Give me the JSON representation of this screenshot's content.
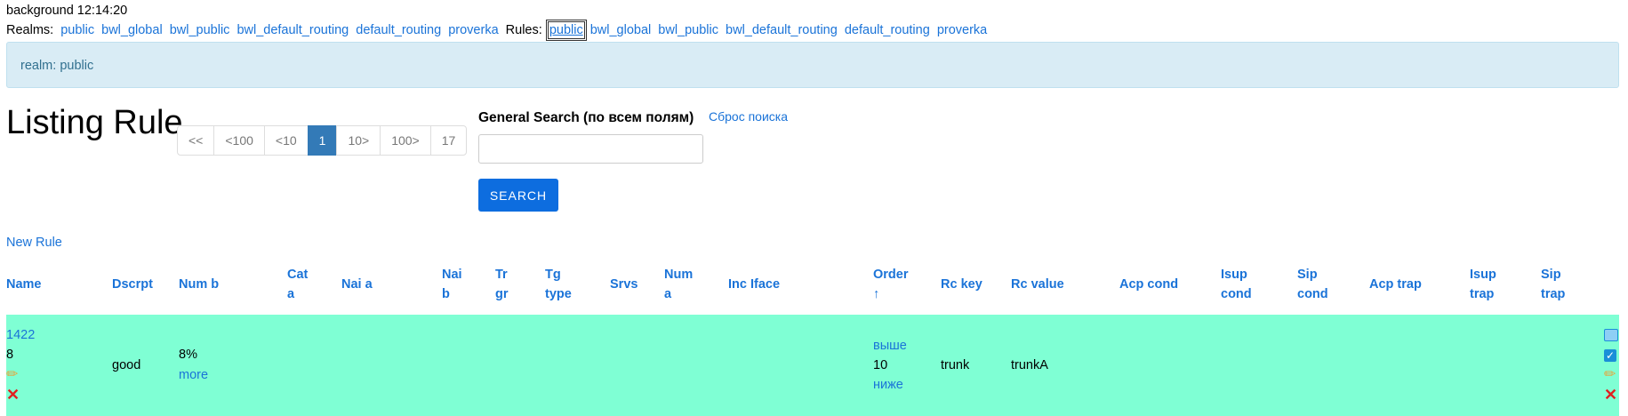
{
  "status": {
    "text": "background 12:14:20"
  },
  "realms": {
    "label": "Realms:",
    "items": [
      "public",
      "bwl_global",
      "bwl_public",
      "bwl_default_routing",
      "default_routing",
      "proverka"
    ]
  },
  "rules_nav": {
    "label": "Rules:",
    "active": "public",
    "items": [
      "bwl_global",
      "bwl_public",
      "bwl_default_routing",
      "default_routing",
      "proverka"
    ]
  },
  "alert": {
    "text": "realm: public"
  },
  "page_title": "Listing Rule",
  "pagination": [
    "<<",
    "<100",
    "<10",
    "1",
    "10>",
    "100>",
    "17"
  ],
  "search": {
    "label": "General Search (по всем полям)",
    "reset": "Сброс поиска",
    "value": "",
    "button": "SEARCH"
  },
  "new_rule": "New Rule",
  "columns": {
    "name": "Name",
    "dscrpt": "Dscrpt",
    "num_b": "Num b",
    "cat_a_1": "Cat",
    "cat_a_2": "a",
    "nai_a": "Nai a",
    "nai_b_1": "Nai",
    "nai_b_2": "b",
    "tr_gr_1": "Tr",
    "tr_gr_2": "gr",
    "tg_type_1": "Tg",
    "tg_type_2": "type",
    "srvs": "Srvs",
    "num_a_1": "Num",
    "num_a_2": "a",
    "inc_iface": "Inc Iface",
    "order_1": "Order",
    "order_2": "↑",
    "rc_key": "Rc key",
    "rc_value": "Rc value",
    "acp_cond": "Acp cond",
    "isup_cond_1": "Isup",
    "isup_cond_2": "cond",
    "sip_cond_1": "Sip",
    "sip_cond_2": "cond",
    "acp_trap": "Acp trap",
    "isup_trap_1": "Isup",
    "isup_trap_2": "trap",
    "sip_trap_1": "Sip",
    "sip_trap_2": "trap"
  },
  "row": {
    "id": "1422",
    "name": "8",
    "dscrpt": "good",
    "num_b": "8%",
    "more": "more",
    "order_up": "выше",
    "order": "10",
    "order_down": "ниже",
    "rc_key": "trunk",
    "rc_value": "trunkA",
    "icons": [
      "pencil-icon",
      "delete-icon",
      "view-icon",
      "check-icon"
    ]
  }
}
